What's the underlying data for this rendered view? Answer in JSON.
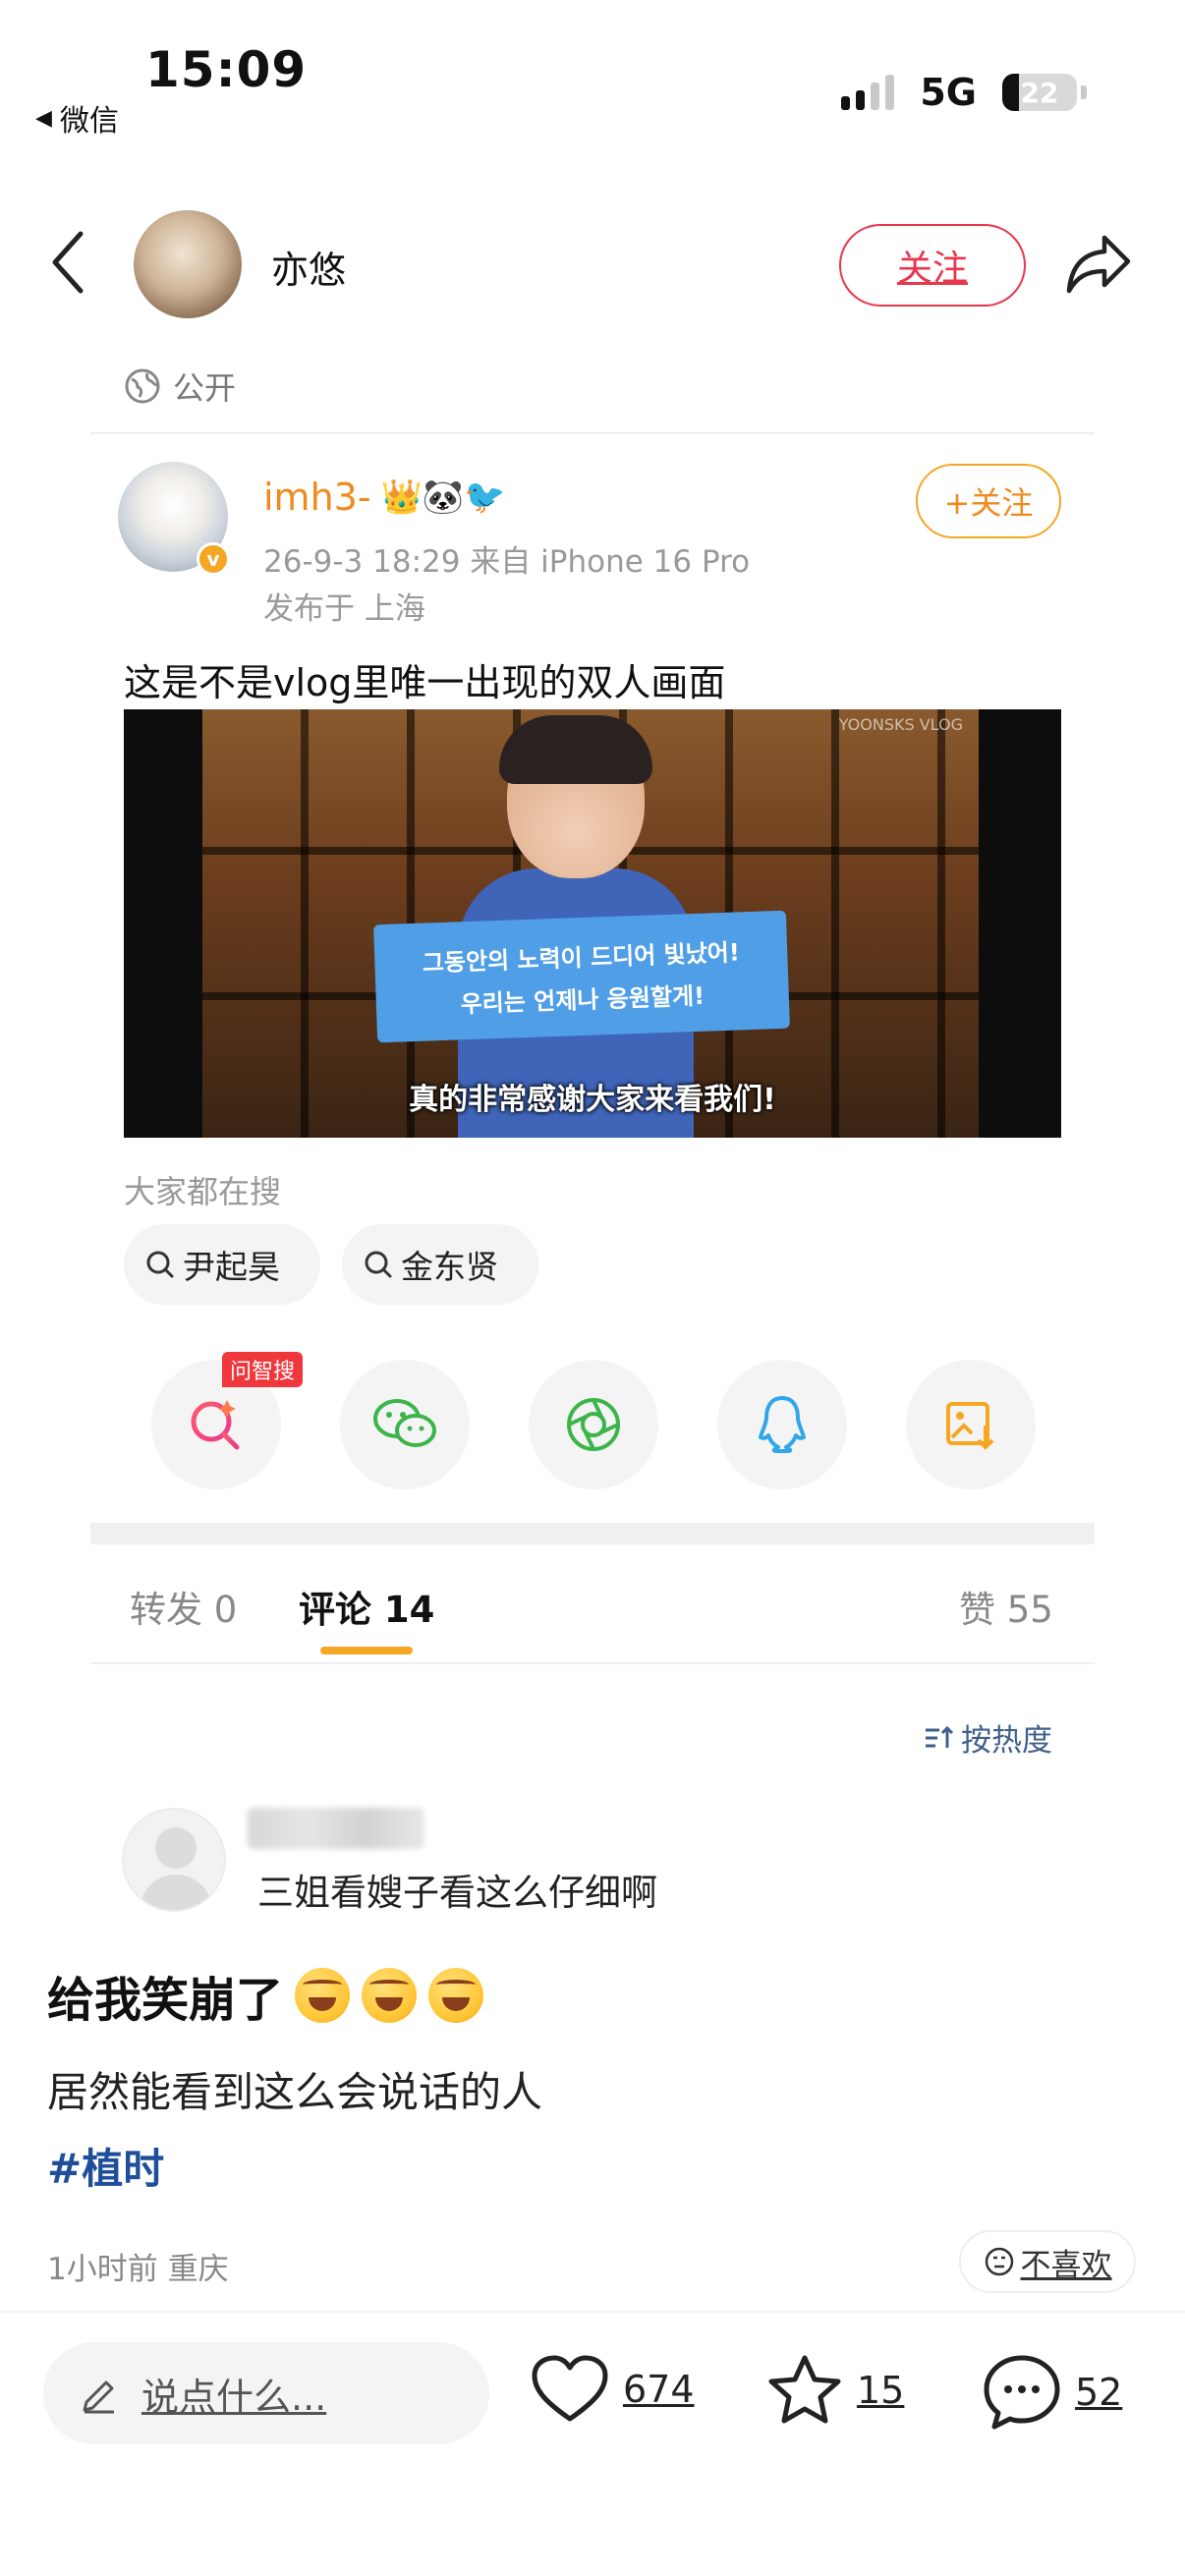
{
  "status_bar": {
    "time": "15:09",
    "back_app": "微信",
    "network": "5G",
    "battery": "22"
  },
  "header": {
    "author_name": "亦悠",
    "follow_label": "关注"
  },
  "visibility": "公开",
  "repost": {
    "username": "imh3-",
    "badges": "👑🐼🐦",
    "follow_label": "+关注",
    "meta": "26-9-3 18:29  来自 iPhone 16 Pro",
    "location": "发布于 上海",
    "text": "这是不是vlog里唯一出现的双人画面",
    "media": {
      "watermark": "YOONSKS VLOG",
      "banner_line1": "그동안의 노력이 드디어 빛났어!",
      "banner_line2": "우리는 언제나 응원할게!",
      "subtitle": "真的非常感谢大家来看我们!"
    }
  },
  "search": {
    "title": "大家都在搜",
    "chips": [
      "尹起昊",
      "金东贤"
    ]
  },
  "share": {
    "ai_badge": "问智搜",
    "icons": [
      "ai-search-icon",
      "wechat-icon",
      "moments-icon",
      "qq-icon",
      "save-image-icon"
    ]
  },
  "tabs": {
    "repost": "转发 0",
    "comment": "评论 14",
    "like": "赞 55"
  },
  "sort_label": "按热度",
  "comment": {
    "text": "三姐看嫂子看这么仔细啊"
  },
  "post": {
    "title": "给我笑崩了",
    "emoji_count": 3,
    "body": "居然能看到这么会说话的人",
    "tag": "#植时",
    "time": "1小时前 重庆",
    "dislike_label": "不喜欢"
  },
  "bottom_bar": {
    "placeholder": "说点什么...",
    "likes": "674",
    "favorites": "15",
    "comments": "52"
  },
  "colors": {
    "accent_red": "#e8364d",
    "accent_orange": "#f5a623",
    "link_blue": "#1f4e9b"
  }
}
